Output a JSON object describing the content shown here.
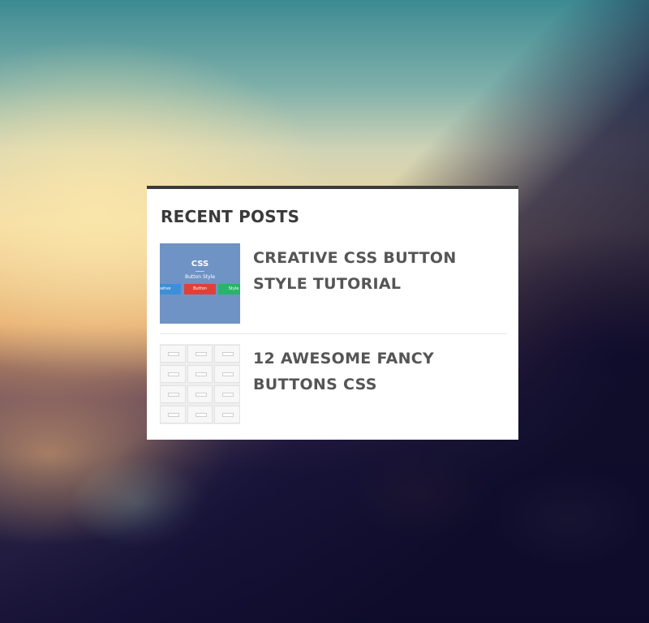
{
  "widget": {
    "title": "RECENT POSTS",
    "posts": [
      {
        "title": "CREATIVE CSS BUTTON STYLE TUTORIAL",
        "thumbnail": {
          "heading": "CSS",
          "subheading": "Button Style",
          "buttons": [
            "Creative",
            "Button",
            "Style"
          ]
        }
      },
      {
        "title": "12 AWESOME FANCY BUTTONS CSS",
        "thumbnail": {}
      }
    ]
  },
  "colors": {
    "widget_border": "#3b3b3b",
    "title_text": "#3a3a3a",
    "link_text": "#555555",
    "thumb1_bg": "#6f93c4",
    "button_blue": "#3c8fd8",
    "button_red": "#e0403a",
    "button_green": "#28b46a"
  }
}
